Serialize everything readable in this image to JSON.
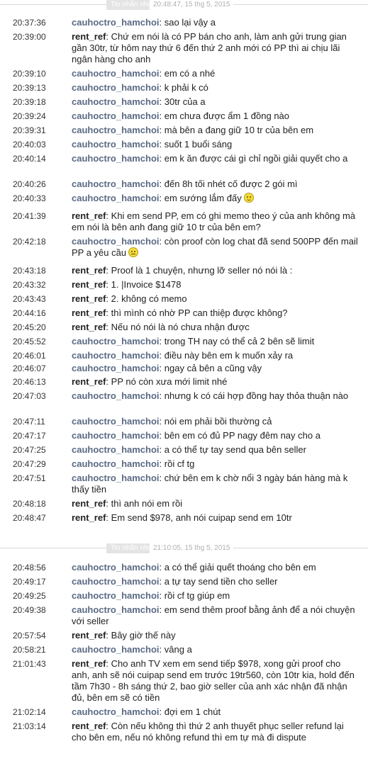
{
  "sections": [
    {
      "header_label": "Tin nhắn nhanh",
      "header_date": "20:48:47, 15 thg 5, 2015",
      "messages": [
        {
          "time": "20:37:36",
          "sender": "cauhoctro_hamchoi",
          "text": "sao lại vậy a"
        },
        {
          "time": "20:39:00",
          "sender": "rent_ref",
          "text": "Chứ em nói là có PP bán cho anh, làm anh gửi trung gian gần 30tr, từ hôm nay thứ 6 đến thứ 2 anh mới có PP thì ai chịu lãi ngân hàng cho anh"
        },
        {
          "time": "20:39:10",
          "sender": "cauhoctro_hamchoi",
          "text": "em có a nhé"
        },
        {
          "time": "20:39:13",
          "sender": "cauhoctro_hamchoi",
          "text": "k phải k có"
        },
        {
          "time": "20:39:18",
          "sender": "cauhoctro_hamchoi",
          "text": "30tr của a"
        },
        {
          "time": "20:39:24",
          "sender": "cauhoctro_hamchoi",
          "text": "em chưa được ẩm 1 đồng nào"
        },
        {
          "time": "20:39:31",
          "sender": "cauhoctro_hamchoi",
          "text": "mà bên a đang giữ 10 tr của bên em"
        },
        {
          "time": "20:40:03",
          "sender": "cauhoctro_hamchoi",
          "text": "suốt 1 buổi sáng"
        },
        {
          "time": "20:40:14",
          "sender": "cauhoctro_hamchoi",
          "text": "em k ăn được cái gì chỉ ngồi giải quyết cho a"
        },
        {
          "time": "20:40:26",
          "sender": "cauhoctro_hamchoi",
          "text": "đến 8h tối nhét cố được 2 gói mì"
        },
        {
          "time": "20:40:33",
          "sender": "cauhoctro_hamchoi",
          "text": "em sướng lắm đấy",
          "emoticon": "smile-emoticon"
        },
        {
          "time": "20:41:39",
          "sender": "rent_ref",
          "text": "Khi em send PP, em có ghi memo theo ý của anh không mà em nói là bên anh đang giữ 10 tr của bên em?"
        },
        {
          "time": "20:42:18",
          "sender": "cauhoctro_hamchoi",
          "text": "còn proof còn log chat đã send 500PP đến mail PP a yêu cầu",
          "emoticon": "neutral-emoticon"
        },
        {
          "time": "20:43:18",
          "sender": "rent_ref",
          "text": "Proof là 1 chuyện, nhưng lỡ seller nó nói là :"
        },
        {
          "time": "20:43:32",
          "sender": "rent_ref",
          "text": "1. |Invoice $1478"
        },
        {
          "time": "20:43:43",
          "sender": "rent_ref",
          "text": "2. không có memo"
        },
        {
          "time": "20:44:16",
          "sender": "rent_ref",
          "text": "thì mình có nhờ PP can thiệp được không?"
        },
        {
          "time": "20:45:20",
          "sender": "rent_ref",
          "text": "Nếu nó nói là nó chưa nhận được"
        },
        {
          "time": "20:45:52",
          "sender": "cauhoctro_hamchoi",
          "text": "trong TH nay có thể cả 2 bên sẽ limit"
        },
        {
          "time": "20:46:01",
          "sender": "cauhoctro_hamchoi",
          "text": "điều này bên em k muốn xảy ra"
        },
        {
          "time": "20:46:07",
          "sender": "cauhoctro_hamchoi",
          "text": "ngay cả bên a cũng vậy"
        },
        {
          "time": "20:46:13",
          "sender": "rent_ref",
          "text": "PP nó còn xưa mới limit nhé"
        },
        {
          "time": "20:47:03",
          "sender": "cauhoctro_hamchoi",
          "text": "nhưng k có cái hợp đồng hay thỏa thuận nào"
        },
        {
          "time": "20:47:11",
          "sender": "cauhoctro_hamchoi",
          "text": "nói em phải bồi thường cả"
        },
        {
          "time": "20:47:17",
          "sender": "cauhoctro_hamchoi",
          "text": "bên em có đủ PP nagy đêm nay cho a"
        },
        {
          "time": "20:47:25",
          "sender": "cauhoctro_hamchoi",
          "text": "a có thể tự tay send qua bên seller"
        },
        {
          "time": "20:47:29",
          "sender": "cauhoctro_hamchoi",
          "text": "rồi cf tg"
        },
        {
          "time": "20:47:51",
          "sender": "cauhoctro_hamchoi",
          "text": "chứ bên em k chờ nổi 3 ngày bán hàng mà k thấy tiền"
        },
        {
          "time": "20:48:18",
          "sender": "rent_ref",
          "text": "thì anh nói em rồi"
        },
        {
          "time": "20:48:47",
          "sender": "rent_ref",
          "text": "Em send $978, anh nói cuipap send em 10tr"
        }
      ]
    },
    {
      "header_label": "Tin nhắn nhanh",
      "header_date": "21:10:05, 15 thg 5, 2015",
      "messages": [
        {
          "time": "20:48:56",
          "sender": "cauhoctro_hamchoi",
          "text": "a có thể giải quết thoáng cho bên em"
        },
        {
          "time": "20:49:17",
          "sender": "cauhoctro_hamchoi",
          "text": "a tự tay send tiền cho seller"
        },
        {
          "time": "20:49:25",
          "sender": "cauhoctro_hamchoi",
          "text": "rồi cf tg giúp em"
        },
        {
          "time": "20:49:38",
          "sender": "cauhoctro_hamchoi",
          "text": "em send thêm proof bằng ảnh để a nói chuyện với seller"
        },
        {
          "time": "20:57:54",
          "sender": "rent_ref",
          "text": "Bây giờ thế này"
        },
        {
          "time": "20:58:21",
          "sender": "cauhoctro_hamchoi",
          "text": "vâng a"
        },
        {
          "time": "21:01:43",
          "sender": "rent_ref",
          "text": "Cho anh TV xem em send tiếp $978, xong gửi proof cho anh, anh sẽ nói cuipap send em trước 19tr560, còn 10tr kia, hold đến tầm 7h30 - 8h sáng thứ 2, bao giờ seller của anh xác nhận đã nhận đủ, bên em sẽ có tiền"
        },
        {
          "time": "21:02:14",
          "sender": "cauhoctro_hamchoi",
          "text": "đợi em 1 chút"
        },
        {
          "time": "21:03:14",
          "sender": "rent_ref",
          "text": "Còn nếu không thì thứ 2 anh thuyết phục seller refund lại cho bên em, nếu nó không refund thì em tự mà đi dispute"
        }
      ]
    }
  ]
}
